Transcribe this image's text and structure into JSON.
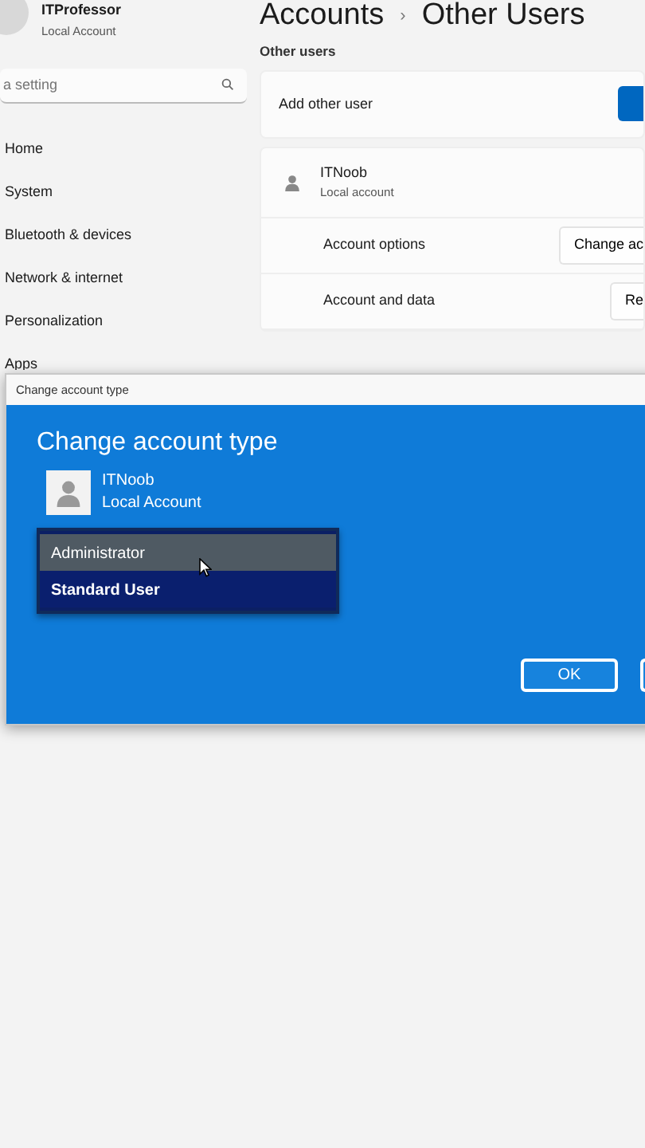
{
  "sidebar": {
    "user": {
      "name": "ITProfessor",
      "account": "Local Account"
    },
    "search": {
      "placeholder": "a setting"
    },
    "items": [
      {
        "label": "Home"
      },
      {
        "label": "System"
      },
      {
        "label": "Bluetooth & devices"
      },
      {
        "label": "Network & internet"
      },
      {
        "label": "Personalization"
      },
      {
        "label": "Apps"
      }
    ]
  },
  "header": {
    "section": "Accounts",
    "separator": "›",
    "page": "Other Users"
  },
  "other_users": {
    "heading": "Other users",
    "add_label": "Add other user",
    "user": {
      "name": "ITNoob",
      "account": "Local account"
    },
    "rows": [
      {
        "label": "Account options",
        "button": "Change ac"
      },
      {
        "label": "Account and data",
        "button": "Re"
      }
    ]
  },
  "dialog": {
    "title": "Change account type",
    "heading": "Change account type",
    "user": {
      "name": "ITNoob",
      "account": "Local Account"
    },
    "options": [
      {
        "label": "Administrator",
        "selected": false,
        "hovered": true
      },
      {
        "label": "Standard User",
        "selected": true,
        "hovered": false
      }
    ],
    "ok": "OK"
  }
}
